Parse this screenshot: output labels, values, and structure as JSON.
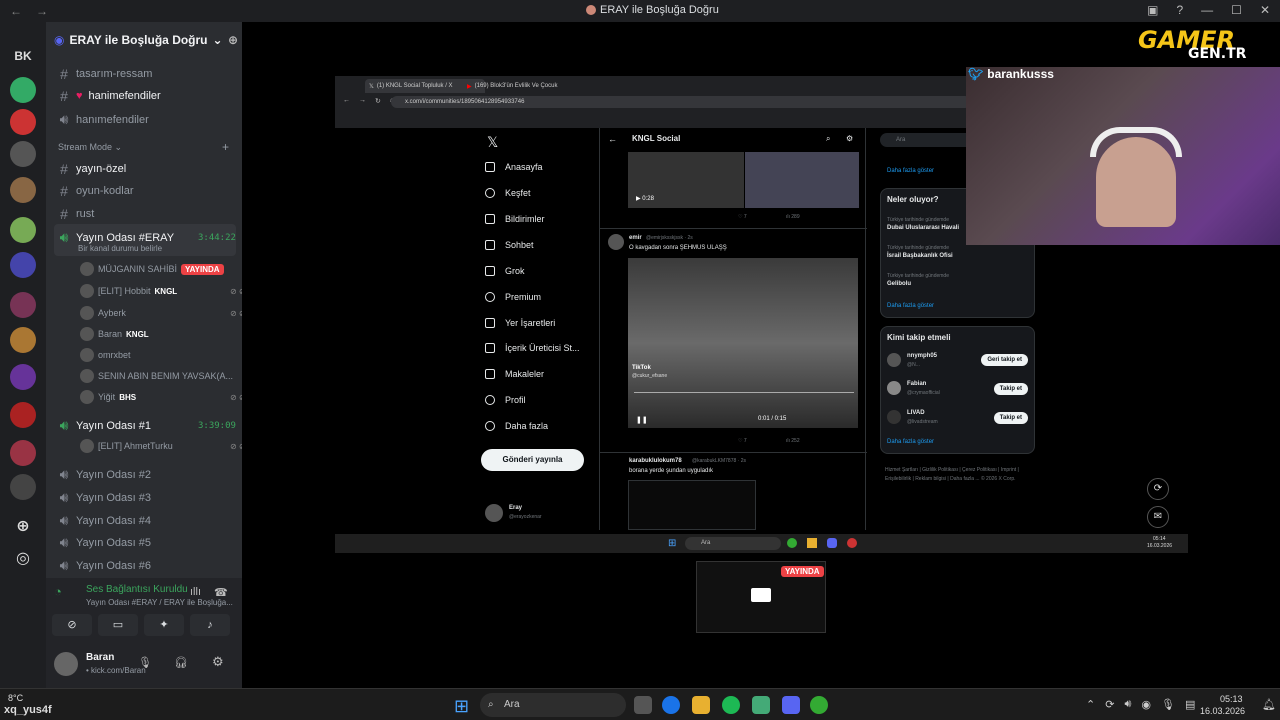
{
  "window": {
    "title": "ERAY ile Boşluğa Doğru",
    "back": "←",
    "forward": "→"
  },
  "server_rail": {
    "label": "BK"
  },
  "guild": {
    "name": "ERAY ile Boşluğa Doğru"
  },
  "channels": [
    {
      "name": "tasarım-ressam",
      "type": "text"
    },
    {
      "name": "hanimefendiler",
      "type": "text",
      "bright": true
    },
    {
      "name": "hanımefendiler",
      "type": "voice"
    }
  ],
  "stream_section": {
    "label": "Stream Mode ⌄"
  },
  "stream_channels": [
    {
      "name": "yayın-özel",
      "type": "text",
      "bright": true
    },
    {
      "name": "oyun-kodlar",
      "type": "text"
    },
    {
      "name": "rust",
      "type": "text"
    }
  ],
  "voice_room": {
    "name": "Yayın Odası #ERAY",
    "time": "3:44:22",
    "status": "Bir kanal durumu belirle"
  },
  "voice_users": [
    {
      "name": "MÜJGANIN SAHİBİ",
      "live": "YAYINDA"
    },
    {
      "name": "[ELIT] Hobbit",
      "tag": "KNGL"
    },
    {
      "name": "Ayberk"
    },
    {
      "name": "Baran",
      "tag": "KNGL"
    },
    {
      "name": "omrxbet"
    },
    {
      "name": "SENIN ABIN BENIM YAVSAK(A..."
    },
    {
      "name": "Yiğit",
      "tag": "BHS"
    }
  ],
  "voice_room2": {
    "name": "Yayın Odası #1",
    "time": "3:39:09"
  },
  "voice_users2": [
    {
      "name": "[ELIT] AhmetTurku"
    }
  ],
  "other_rooms": [
    "Yayın Odası #2",
    "Yayın Odası #3",
    "Yayın Odası #4",
    "Yayın Odası #5",
    "Yayın Odası #6"
  ],
  "voice_panel": {
    "status": "Ses Bağlantısı Kuruldu",
    "sub": "Yayın Odası #ERAY / ERAY ile Boşluğa..."
  },
  "user_panel": {
    "name": "Baran",
    "sub": "• kick.com/Baran"
  },
  "browser": {
    "tabs": [
      "(1) KNGL Social Topluluk / X",
      "(169) Blok3'ün Evlilik Ve Çocuk"
    ],
    "url": "x.com/i/communities/1895064128954933746"
  },
  "x_nav": [
    "Anasayfa",
    "Keşfet",
    "Bildirimler",
    "Sohbet",
    "Grok",
    "Premium",
    "Yer İşaretleri",
    "İçerik Üreticisi St...",
    "Makaleler",
    "Profil",
    "Daha fazla"
  ],
  "x_post_button": "Gönderi yayınla",
  "x_account": {
    "name": "Eray",
    "handle": "@erayozkenar"
  },
  "feed": {
    "header": "KNGL Social",
    "video1_time": "0:28",
    "post1_stats": {
      "likes": "7",
      "views": "289"
    },
    "post2": {
      "author": "emir",
      "handle": "@emirjsksskjssk · 2s",
      "text": "O kavgadan sonra ŞEHMUS ULAŞŞ",
      "tiktok": "TikTok",
      "tiktok_user": "@cukur_efsane",
      "time": "0:01 / 0:15",
      "likes": "7",
      "views": "252"
    },
    "post3": {
      "author": "karabuklulokum78",
      "handle": "@karabukLKM7878 · 2s",
      "text": "borana yerde şundan uyguladık"
    }
  },
  "right": {
    "search": "Ara",
    "more1": "Daha fazla göster",
    "trends_title": "Neler oluyor?",
    "trends": [
      {
        "ctx": "Türkiye tarihinde gündemde",
        "name": "Dubai Uluslararası Havali"
      },
      {
        "ctx": "Türkiye tarihinde gündemde",
        "name": "İsrail Başbakanlık Ofisi"
      },
      {
        "ctx": "Türkiye tarihinde gündemde",
        "name": "Gelibolu"
      }
    ],
    "more2": "Daha fazla göster",
    "follow_title": "Kimi takip etmeli",
    "follow": [
      {
        "name": "nnymph05",
        "handle": "@N...",
        "btn": "Geri takip et"
      },
      {
        "name": "Fabian",
        "handle": "@crymaofficial",
        "btn": "Takip et"
      },
      {
        "name": "LIVAD",
        "handle": "@livadstream",
        "btn": "Takip et"
      }
    ],
    "more3": "Daha fazla göster",
    "footer": "Hizmet Şartları | Gizlilik Politikası | Çerez Politikası | Imprint | Erişilebilirlik | Reklam bilgisi | Daha fazla ... © 2026 X Corp."
  },
  "inner_taskbar": {
    "search": "Ara",
    "time": "05:14",
    "date": "16.03.2026"
  },
  "cam": {
    "user": "barankusss"
  },
  "brand": {
    "line1": "GAMER",
    "line2": "GEN.TR"
  },
  "mini": {
    "live": "YAYINDA"
  },
  "taskbar": {
    "weather": "8°C",
    "weather2": "xq_yus4f",
    "search": "Ara",
    "time": "05:13",
    "date": "16.03.2026"
  },
  "colors": {
    "accent": "#5865f2",
    "live": "#ed4245",
    "green": "#3ba55d",
    "brand_yellow": "#f5c518"
  }
}
